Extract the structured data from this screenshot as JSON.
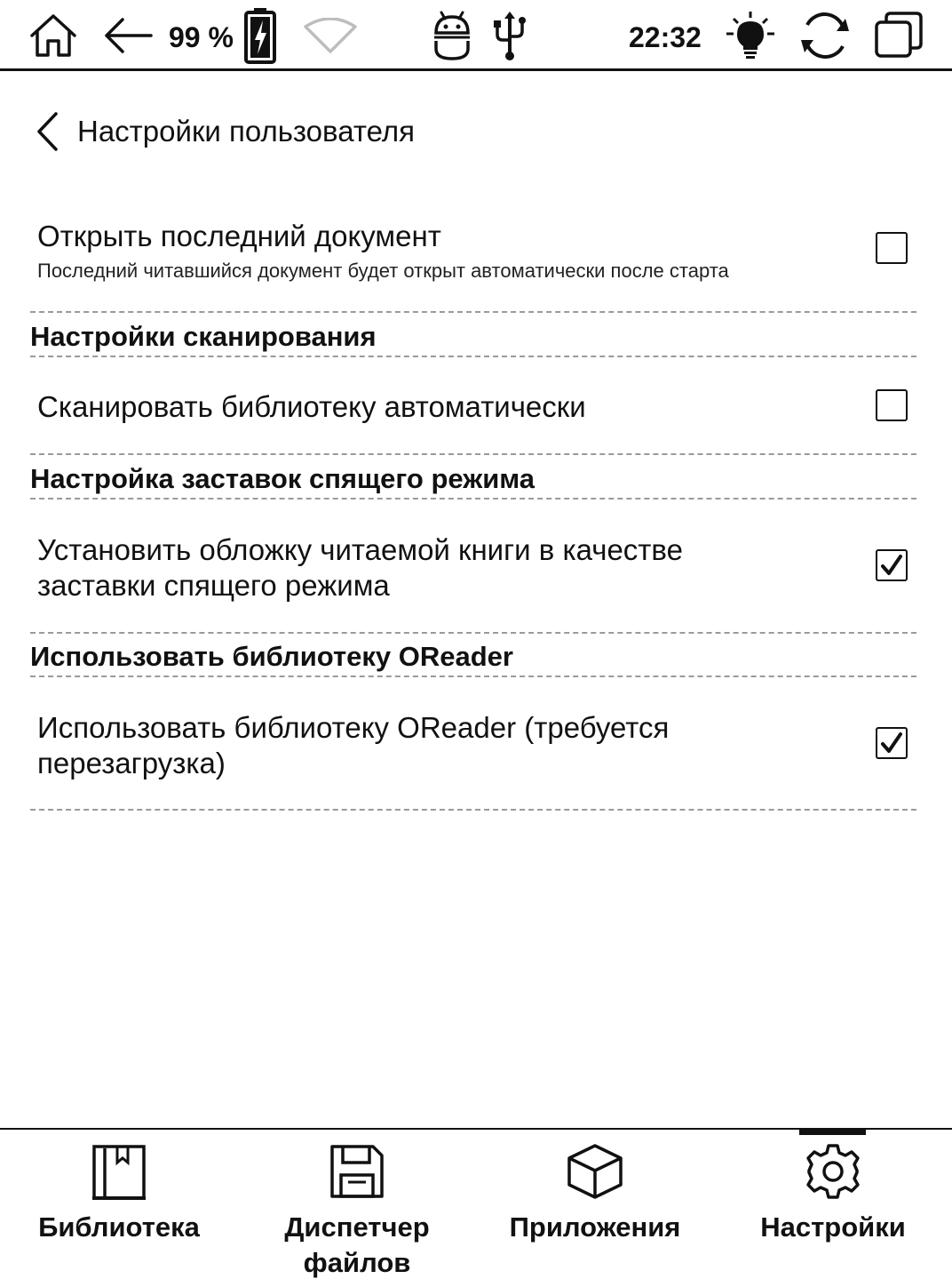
{
  "status_bar": {
    "battery_percent": "99 %",
    "time": "22:32",
    "icons": [
      "home-icon",
      "back-arrow-icon",
      "battery-charging-icon",
      "wifi-icon",
      "android-icon",
      "usb-icon",
      "frontlight-icon",
      "refresh-icon",
      "multitask-icon"
    ]
  },
  "header": {
    "title": "Настройки пользователя"
  },
  "settings": {
    "open_last_document": {
      "title": "Открыть последний документ",
      "description": "Последний читавшийся документ будет открыт автоматически после старта",
      "checked": false
    },
    "scan_section": {
      "title": "Настройки сканирования"
    },
    "scan_library": {
      "title": "Сканировать библиотеку автоматически",
      "checked": false
    },
    "screensaver_section": {
      "title": "Настройка заставок спящего режима"
    },
    "cover_screensaver": {
      "title_line1": "Установить обложку читаемой книги в качестве",
      "title_line2": "заставки спящего режима",
      "checked": true
    },
    "oreader_section": {
      "title": "Использовать библиотеку OReader"
    },
    "use_oreader": {
      "title_line1": "Использовать библиотеку OReader (требуется",
      "title_line2": "перезагрузка)",
      "checked": true
    }
  },
  "bottom_nav": {
    "items": [
      {
        "label": "Библиотека",
        "icon": "library-icon"
      },
      {
        "label_line1": "Диспетчер",
        "label_line2": "файлов",
        "icon": "file-manager-icon"
      },
      {
        "label": "Приложения",
        "icon": "apps-icon"
      },
      {
        "label": "Настройки",
        "icon": "settings-gear-icon",
        "active": true
      }
    ]
  }
}
